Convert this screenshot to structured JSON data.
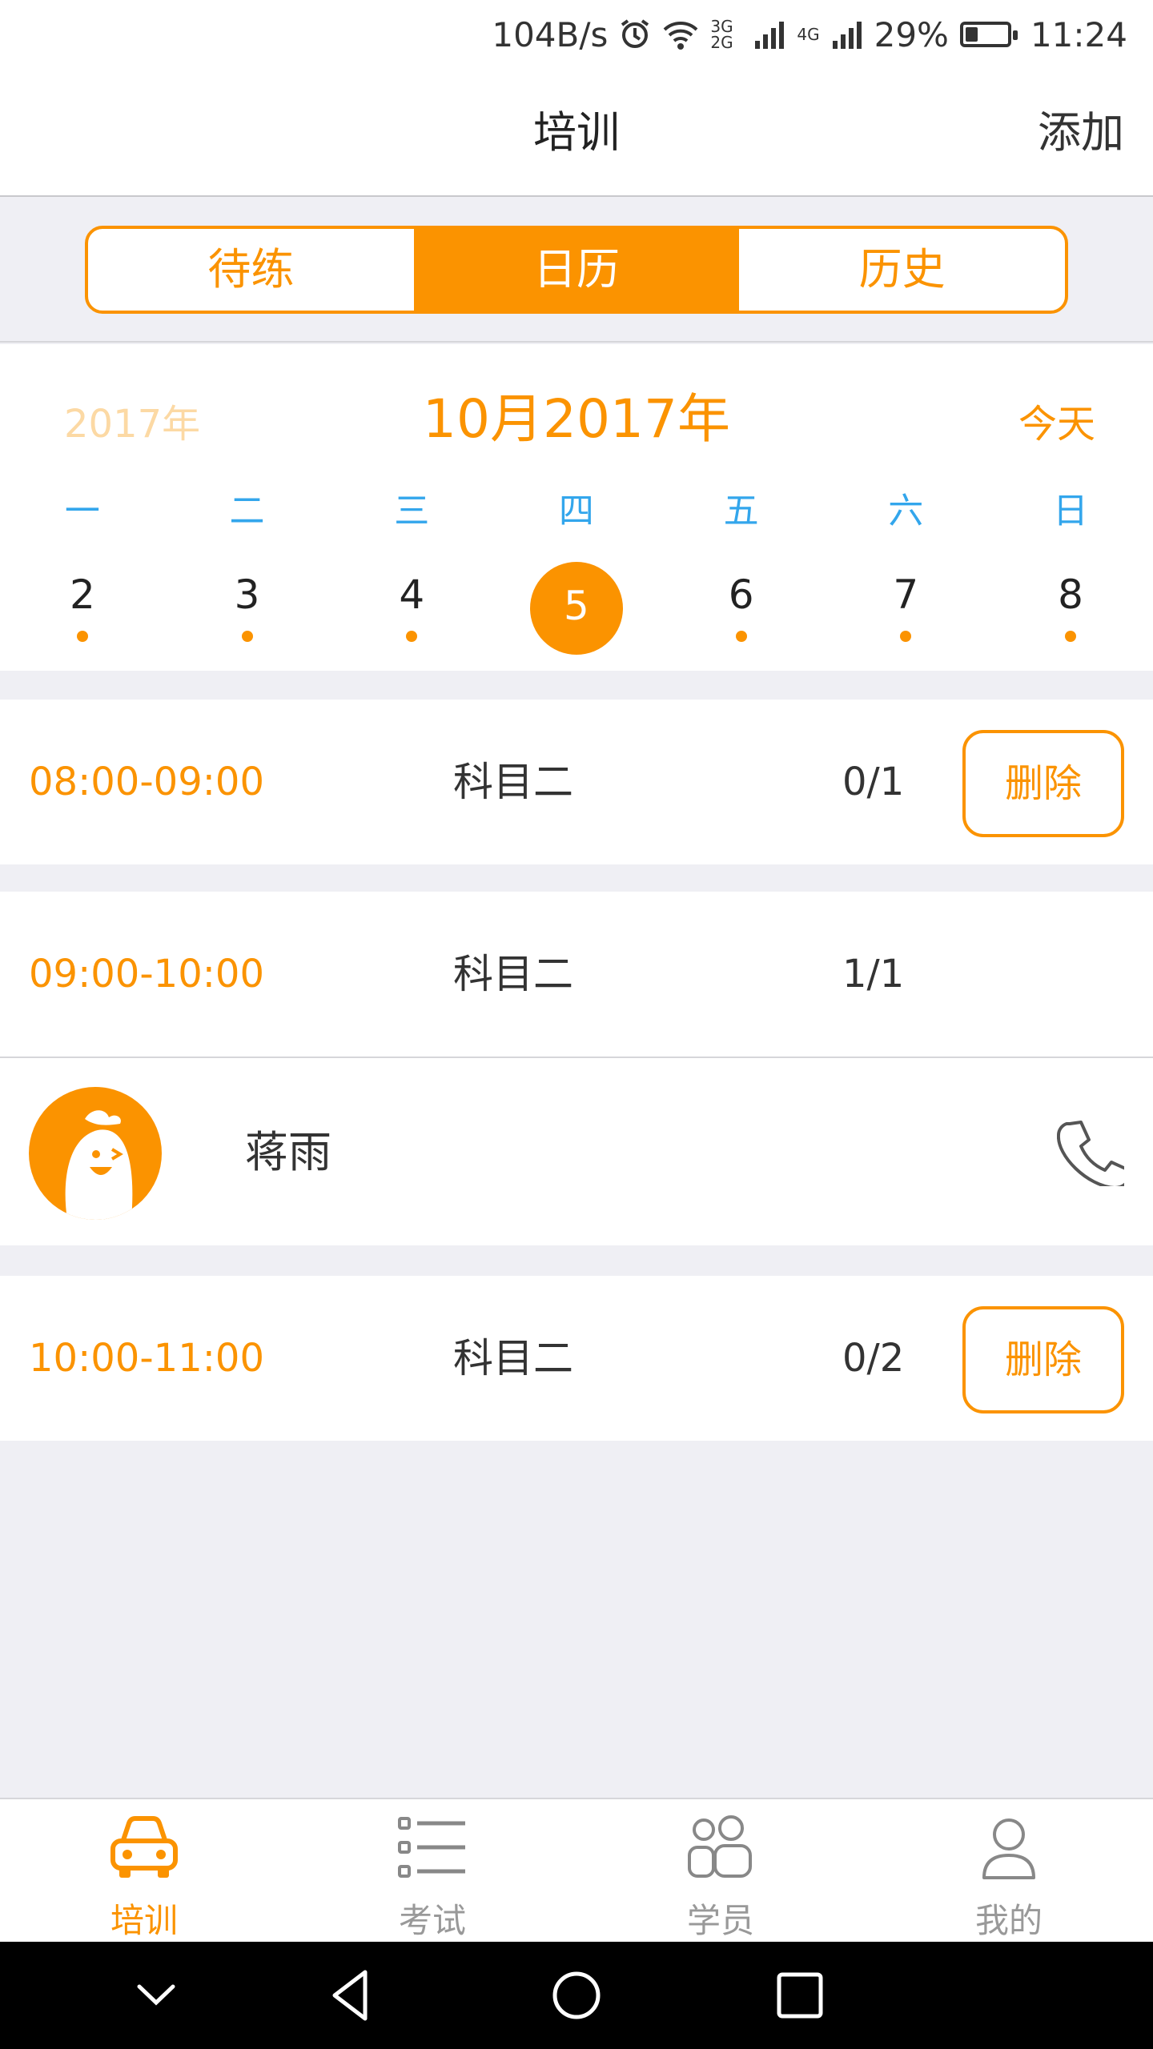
{
  "status_bar": {
    "net_speed": "104B/s",
    "signal_3g": "3G 2G",
    "signal_4g": "4G",
    "battery": "29%",
    "battery_level": 0.29,
    "time": "11:24",
    "icons": [
      "alarm-icon",
      "wifi-icon",
      "cell-signal-icon",
      "battery-icon"
    ]
  },
  "nav": {
    "title": "培训",
    "action": "添加"
  },
  "segment": {
    "tabs": [
      {
        "label": "待练",
        "active": false
      },
      {
        "label": "日历",
        "active": true
      },
      {
        "label": "历史",
        "active": false
      }
    ]
  },
  "calendar": {
    "year": "2017年",
    "month_title": "10月2017年",
    "today": "今天",
    "weekdays": [
      "一",
      "二",
      "三",
      "四",
      "五",
      "六",
      "日"
    ],
    "dates": [
      "2",
      "3",
      "4",
      "5",
      "6",
      "7",
      "8"
    ],
    "selected_date": "5"
  },
  "sessions": [
    {
      "time": "08:00-09:00",
      "subject": "科目二",
      "count": "0/1",
      "delete": "删除"
    },
    {
      "time": "09:00-10:00",
      "subject": "科目二",
      "count": "1/1"
    },
    {
      "time": "10:00-11:00",
      "subject": "科目二",
      "count": "0/2",
      "delete": "删除"
    }
  ],
  "student": {
    "name": "蒋雨",
    "avatar": "mascot-avatar",
    "action_icon": "phone-icon"
  },
  "tabbar": {
    "items": [
      {
        "label": "培训",
        "icon": "car-icon",
        "active": true
      },
      {
        "label": "考试",
        "icon": "list-icon",
        "active": false
      },
      {
        "label": "学员",
        "icon": "students-icon",
        "active": false
      },
      {
        "label": "我的",
        "icon": "user-icon",
        "active": false
      }
    ]
  },
  "colors": {
    "accent": "#fb9300",
    "weekday": "#33a6ec",
    "background": "#efeff4"
  }
}
